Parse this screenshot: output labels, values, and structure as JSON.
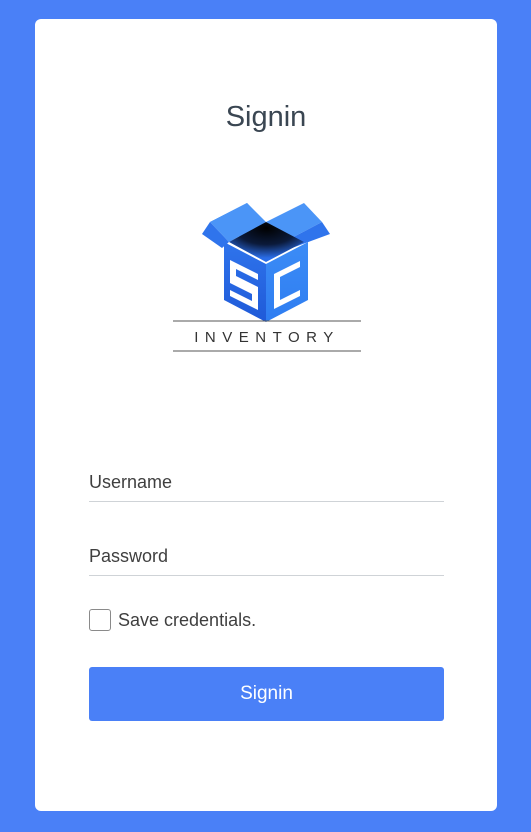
{
  "form": {
    "title": "Signin",
    "username_placeholder": "Username",
    "password_placeholder": "Password",
    "remember_label": "Save credentials.",
    "remember_checked": false,
    "submit_label": "Signin"
  },
  "logo": {
    "icon": "box-logo-icon",
    "wordmark": "INVENTORY",
    "letters": "SC"
  },
  "colors": {
    "background": "#4a80f7",
    "card": "#ffffff",
    "accent": "#4a80f7",
    "title_text": "#3a4652",
    "logo_dark": "#1a4fd0",
    "logo_light": "#3d8cf5"
  }
}
